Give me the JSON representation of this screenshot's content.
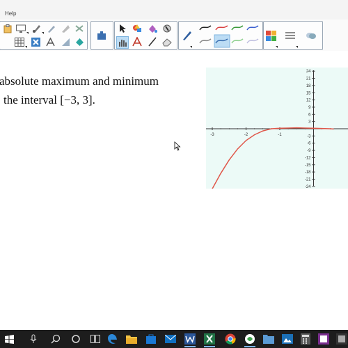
{
  "menu": {
    "help_label": "Help"
  },
  "question": {
    "line1": "absolute maximum and minimum",
    "line2": "the interval [−3, 3]."
  },
  "chart_data": {
    "type": "line",
    "x_ticks": [
      "-3",
      "-2",
      "-1"
    ],
    "y_ticks": [
      "24",
      "21",
      "18",
      "15",
      "12",
      "9",
      "6",
      "3",
      "-3",
      "-6",
      "-9",
      "-12",
      "-15",
      "-18",
      "-21",
      "-24"
    ],
    "xlim": [
      -3,
      0.6
    ],
    "ylim": [
      -24,
      24
    ],
    "grid": false,
    "series": [
      {
        "color": "#e0574a",
        "x": [
          -3.0,
          -2.75,
          -2.5,
          -2.25,
          -2.0,
          -1.75,
          -1.5,
          -1.25,
          -1.0,
          -0.75,
          -0.5,
          -0.25,
          0.0,
          0.25,
          0.5,
          0.6
        ],
        "y": [
          -25,
          -18.6,
          -13.0,
          -8.4,
          -4.9,
          -2.5,
          -0.9,
          0.0,
          0.2,
          0.3,
          0.4,
          0.3,
          0.2,
          0.1,
          0.0,
          -0.1
        ]
      }
    ]
  },
  "colors": {
    "curve": "#e0574a",
    "graph_bg": "#ecfaf7",
    "taskbar": "#1d1d1d",
    "ribbon_border": "#9aa7b5"
  },
  "ribbon_icons": [
    "clipboard-icon",
    "screen-icon",
    "pen-tool-icon",
    "highlighter-icon",
    "shape-icon",
    "color-eraser-icon",
    "table-icon",
    "delete-icon",
    "text-icon",
    "shape-fill-icon",
    "fill-icon",
    "puzzle-icon",
    "select-icon",
    "shapes-icon",
    "fill-bucket-icon",
    "magic-pen-icon",
    "multitouch-icon",
    "text-tool-icon",
    "line-icon",
    "eraser-icon",
    "pen-icon",
    "line-style-icon",
    "properties-icon",
    "more-icon"
  ],
  "taskbar_icons": [
    "windows-start-icon",
    "search-icon",
    "task-view-icon",
    "edge-icon",
    "file-explorer-icon",
    "store-icon",
    "mail-icon",
    "excel-icon",
    "word-icon",
    "chrome-icon",
    "smart-notebook-icon",
    "folder-icon",
    "calculator-icon",
    "notebook-icon"
  ]
}
